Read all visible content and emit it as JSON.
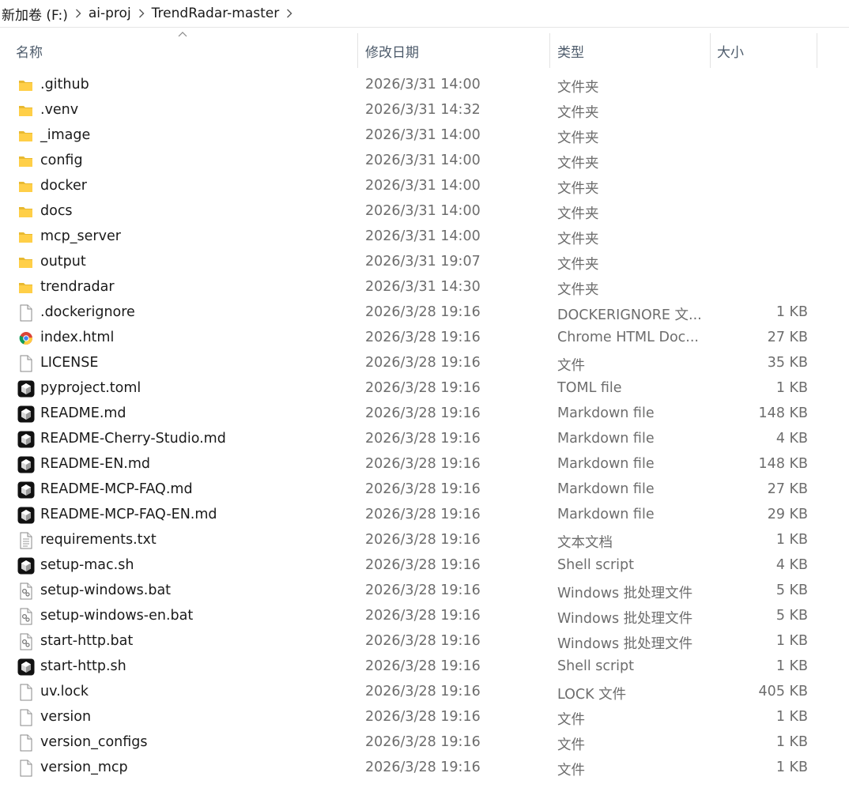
{
  "breadcrumb": [
    "新加卷 (F:)",
    "ai-proj",
    "TrendRadar-master"
  ],
  "columns": {
    "name": "名称",
    "date": "修改日期",
    "type": "类型",
    "size": "大小"
  },
  "files": [
    {
      "name": ".github",
      "date": "2026/3/31 14:00",
      "type": "文件夹",
      "size": "",
      "icon": "folder-icon"
    },
    {
      "name": ".venv",
      "date": "2026/3/31 14:32",
      "type": "文件夹",
      "size": "",
      "icon": "folder-icon"
    },
    {
      "name": "_image",
      "date": "2026/3/31 14:00",
      "type": "文件夹",
      "size": "",
      "icon": "folder-icon"
    },
    {
      "name": "config",
      "date": "2026/3/31 14:00",
      "type": "文件夹",
      "size": "",
      "icon": "folder-icon"
    },
    {
      "name": "docker",
      "date": "2026/3/31 14:00",
      "type": "文件夹",
      "size": "",
      "icon": "folder-icon"
    },
    {
      "name": "docs",
      "date": "2026/3/31 14:00",
      "type": "文件夹",
      "size": "",
      "icon": "folder-icon"
    },
    {
      "name": "mcp_server",
      "date": "2026/3/31 14:00",
      "type": "文件夹",
      "size": "",
      "icon": "folder-icon"
    },
    {
      "name": "output",
      "date": "2026/3/31 19:07",
      "type": "文件夹",
      "size": "",
      "icon": "folder-icon"
    },
    {
      "name": "trendradar",
      "date": "2026/3/31 14:30",
      "type": "文件夹",
      "size": "",
      "icon": "folder-icon"
    },
    {
      "name": ".dockerignore",
      "date": "2026/3/28 19:16",
      "type": "DOCKERIGNORE 文...",
      "size": "1 KB",
      "icon": "blank-file-icon"
    },
    {
      "name": "index.html",
      "date": "2026/3/28 19:16",
      "type": "Chrome HTML Doc...",
      "size": "27 KB",
      "icon": "chrome-icon"
    },
    {
      "name": "LICENSE",
      "date": "2026/3/28 19:16",
      "type": "文件",
      "size": "35 KB",
      "icon": "blank-file-icon"
    },
    {
      "name": "pyproject.toml",
      "date": "2026/3/28 19:16",
      "type": "TOML file",
      "size": "1 KB",
      "icon": "editor-app-icon"
    },
    {
      "name": "README.md",
      "date": "2026/3/28 19:16",
      "type": "Markdown file",
      "size": "148 KB",
      "icon": "editor-app-icon"
    },
    {
      "name": "README-Cherry-Studio.md",
      "date": "2026/3/28 19:16",
      "type": "Markdown file",
      "size": "4 KB",
      "icon": "editor-app-icon"
    },
    {
      "name": "README-EN.md",
      "date": "2026/3/28 19:16",
      "type": "Markdown file",
      "size": "148 KB",
      "icon": "editor-app-icon"
    },
    {
      "name": "README-MCP-FAQ.md",
      "date": "2026/3/28 19:16",
      "type": "Markdown file",
      "size": "27 KB",
      "icon": "editor-app-icon"
    },
    {
      "name": "README-MCP-FAQ-EN.md",
      "date": "2026/3/28 19:16",
      "type": "Markdown file",
      "size": "29 KB",
      "icon": "editor-app-icon"
    },
    {
      "name": "requirements.txt",
      "date": "2026/3/28 19:16",
      "type": "文本文档",
      "size": "1 KB",
      "icon": "text-file-icon"
    },
    {
      "name": "setup-mac.sh",
      "date": "2026/3/28 19:16",
      "type": "Shell script",
      "size": "4 KB",
      "icon": "editor-app-icon"
    },
    {
      "name": "setup-windows.bat",
      "date": "2026/3/28 19:16",
      "type": "Windows 批处理文件",
      "size": "5 KB",
      "icon": "batch-file-icon"
    },
    {
      "name": "setup-windows-en.bat",
      "date": "2026/3/28 19:16",
      "type": "Windows 批处理文件",
      "size": "5 KB",
      "icon": "batch-file-icon"
    },
    {
      "name": "start-http.bat",
      "date": "2026/3/28 19:16",
      "type": "Windows 批处理文件",
      "size": "1 KB",
      "icon": "batch-file-icon"
    },
    {
      "name": "start-http.sh",
      "date": "2026/3/28 19:16",
      "type": "Shell script",
      "size": "1 KB",
      "icon": "editor-app-icon"
    },
    {
      "name": "uv.lock",
      "date": "2026/3/28 19:16",
      "type": "LOCK 文件",
      "size": "405 KB",
      "icon": "blank-file-icon"
    },
    {
      "name": "version",
      "date": "2026/3/28 19:16",
      "type": "文件",
      "size": "1 KB",
      "icon": "blank-file-icon"
    },
    {
      "name": "version_configs",
      "date": "2026/3/28 19:16",
      "type": "文件",
      "size": "1 KB",
      "icon": "blank-file-icon"
    },
    {
      "name": "version_mcp",
      "date": "2026/3/28 19:16",
      "type": "文件",
      "size": "1 KB",
      "icon": "blank-file-icon"
    }
  ]
}
